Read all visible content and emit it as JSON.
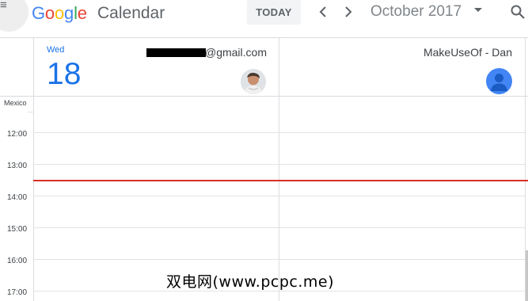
{
  "topbar": {
    "logo_letters": [
      "G",
      "o",
      "o",
      "g",
      "l",
      "e"
    ],
    "app_name": "Calendar",
    "today_label": "TODAY",
    "month_label": "October 2017",
    "icons": [
      "menu-icon",
      "chevron-left-icon",
      "chevron-right-icon",
      "dropdown-caret-icon",
      "search-icon"
    ]
  },
  "day_header": {
    "weekday": "Wed",
    "day_number": "18"
  },
  "calendars": [
    {
      "name_visible": "@gmail.com",
      "name_redacted": true,
      "avatar": "photo-avatar"
    },
    {
      "name": "MakeUseOf - Dan",
      "avatar": "default-person-avatar"
    }
  ],
  "timegrid": {
    "timezone_label": "Mexico",
    "hours": [
      "12:00",
      "13:00",
      "14:00",
      "15:00",
      "16:00",
      "17:00"
    ]
  },
  "colors": {
    "accent_blue": "#1a73e8",
    "current_time_line": "#d93025",
    "google_blue": "#4285f4",
    "google_red": "#ea4335",
    "google_yellow": "#fbbc05",
    "google_green": "#34a853"
  },
  "watermark": "双电网(www.pcpc.me)"
}
